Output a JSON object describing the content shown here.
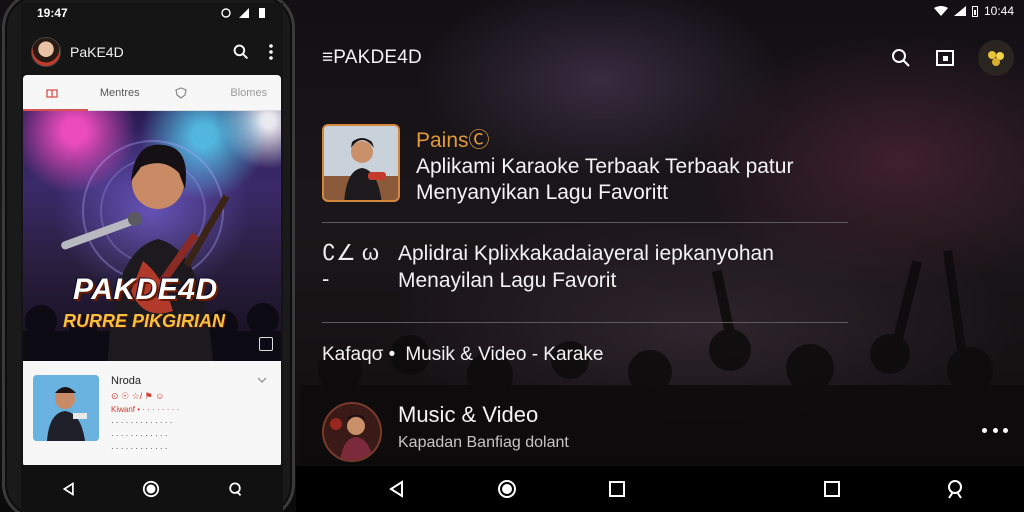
{
  "right": {
    "status_time": "10:44",
    "app_title": "≡PAKDE4D",
    "items": [
      {
        "tag": "PainsⒸ",
        "title_line1": "Aplikami Karaoke Terbaak Terbaak patur",
        "title_line2": "Menyanyikan Lagu Favoritt"
      },
      {
        "glyph": "∁∠ ω -",
        "line1": "Aplidrai Kplixkakadaiayeral  iepkanyohan",
        "line2": "Menayilan Lagu Favorit"
      },
      {
        "lead": "Kafaqσ •",
        "text": "Musik & Video - Karake"
      },
      {
        "title": "Music & Video",
        "subtitle": "Kapadan Banfiag dolant"
      }
    ]
  },
  "phone": {
    "status_time": "19:47",
    "app_title": "PaKE4D",
    "tabs": [
      "",
      "Mentres",
      "",
      "Blomes"
    ],
    "banner_logo": "PAKDE4D",
    "banner_subtitle": "RURRE PIKGIRIAN",
    "list_item": {
      "title": "Nroda",
      "meta": "⊙ ☉ ☆/ ⚑ ☺",
      "desc_line1": "Kiwanf • · · · · · · · ·",
      "desc_line2": "· · · · · · · · · · · · ·",
      "desc_line3": "· · · · · · · · · · · ·",
      "desc_line4": "· · · · · · · · · · · ·"
    }
  },
  "colors": {
    "accent_orange": "#e39a3a",
    "accent_red": "#d9534f",
    "text_light": "#f2f2f2"
  }
}
